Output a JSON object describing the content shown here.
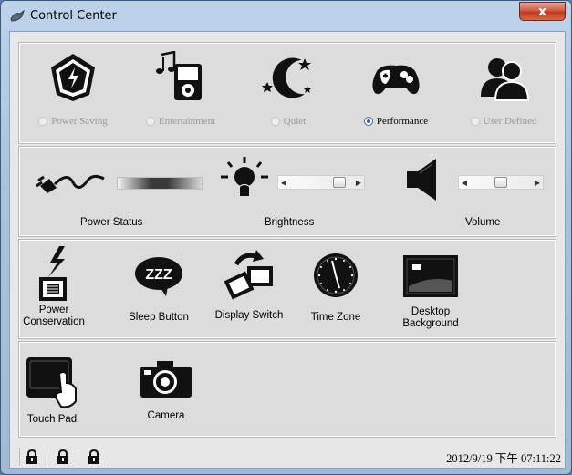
{
  "window": {
    "title": "Control Center",
    "close_label": "x"
  },
  "modes": [
    {
      "label": "Power Saving",
      "icon": "power-saving-icon",
      "selected": false
    },
    {
      "label": "Entertainment",
      "icon": "entertainment-icon",
      "selected": false
    },
    {
      "label": "Quiet",
      "icon": "quiet-icon",
      "selected": false
    },
    {
      "label": "Performance",
      "icon": "performance-icon",
      "selected": true
    },
    {
      "label": "User Defined",
      "icon": "user-defined-icon",
      "selected": false
    }
  ],
  "controls": {
    "power_status": {
      "label": "Power Status",
      "icon": "power-plug-icon"
    },
    "brightness": {
      "label": "Brightness",
      "icon": "lightbulb-icon",
      "level": 0.85
    },
    "volume": {
      "label": "Volume",
      "icon": "speaker-icon",
      "level": 0.5
    }
  },
  "tools": [
    {
      "label_lines": [
        "Power",
        "Conservation"
      ],
      "icon": "power-conservation-icon"
    },
    {
      "label_lines": [
        "Sleep Button"
      ],
      "icon": "sleep-button-icon"
    },
    {
      "label_lines": [
        "Display Switch"
      ],
      "icon": "display-switch-icon"
    },
    {
      "label_lines": [
        "Time Zone"
      ],
      "icon": "time-zone-icon"
    },
    {
      "label_lines": [
        "Desktop",
        "Background"
      ],
      "icon": "desktop-background-icon"
    }
  ],
  "devices": [
    {
      "label": "Touch Pad",
      "icon": "touch-pad-icon"
    },
    {
      "label": "Camera",
      "icon": "camera-icon"
    }
  ],
  "status_bar": {
    "icons": [
      "lock-icon",
      "lock-icon",
      "lock-icon"
    ],
    "datetime": "2012/9/19 下午 07:11:22"
  },
  "sleep_icon_text": "ZZZ"
}
